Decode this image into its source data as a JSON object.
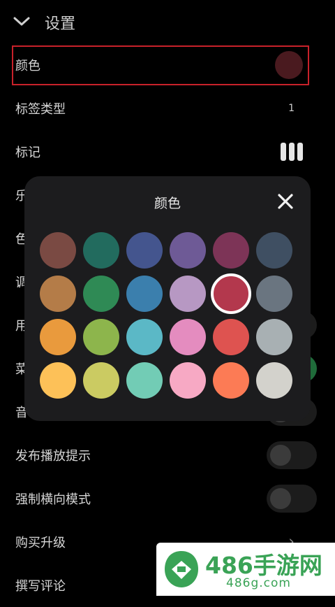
{
  "header": {
    "title": "设置"
  },
  "rows": [
    {
      "label": "颜色"
    },
    {
      "label": "标签类型",
      "value": "1"
    },
    {
      "label": "标记"
    },
    {
      "label": "乐"
    },
    {
      "label": "色"
    },
    {
      "label": "调"
    },
    {
      "label": "用"
    },
    {
      "label": "菜"
    },
    {
      "label": "音"
    },
    {
      "label": "发布播放提示"
    },
    {
      "label": "强制横向模式"
    },
    {
      "label": "购买升级"
    },
    {
      "label": "撰写评论"
    }
  ],
  "current_color": "#4a1a1f",
  "dialog": {
    "title": "颜色",
    "selected_index": 10,
    "colors": [
      "#7a4a43",
      "#226b5e",
      "#44558e",
      "#6e5a96",
      "#7d3457",
      "#3f4f62",
      "#b47c48",
      "#2f8a55",
      "#3b7fad",
      "#b798c3",
      "#b3384d",
      "#6a7580",
      "#e99a3d",
      "#8db54c",
      "#5bb8c6",
      "#e48cbf",
      "#de5350",
      "#a8b0b3",
      "#fdc158",
      "#cbcb62",
      "#72ccb5",
      "#f7a9c4",
      "#fc7b55",
      "#d3d2cc"
    ]
  },
  "watermark": {
    "name": "486手游网",
    "url": "486g.com"
  }
}
